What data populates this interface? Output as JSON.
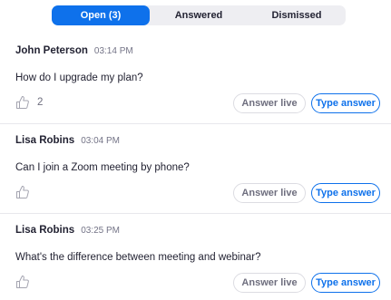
{
  "tabs": {
    "open": "Open (3)",
    "answered": "Answered",
    "dismissed": "Dismissed"
  },
  "questions": [
    {
      "name": "John Peterson",
      "time": "03:14 PM",
      "text": "How do I upgrade my plan?",
      "likes": "2"
    },
    {
      "name": "Lisa Robins",
      "time": "03:04 PM",
      "text": "Can I join a Zoom meeting by phone?",
      "likes": ""
    },
    {
      "name": "Lisa Robins",
      "time": "03:25 PM",
      "text": "What's the difference between meeting and webinar?",
      "likes": ""
    }
  ],
  "actions": {
    "answer_live": "Answer live",
    "type_answer": "Type answer"
  },
  "colors": {
    "accent": "#0e71eb",
    "tab_bg": "#eeeef2",
    "divider": "#e8e8ec"
  },
  "icons": {
    "like": "thumbs-up-icon"
  }
}
